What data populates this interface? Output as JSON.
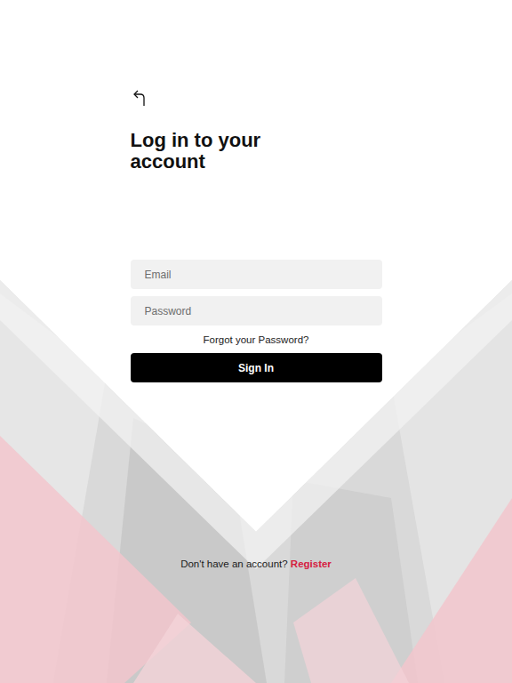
{
  "title": "Log in to your account",
  "form": {
    "email": {
      "placeholder": "Email"
    },
    "password": {
      "placeholder": "Password"
    },
    "forgot": "Forgot your Password?",
    "submit": "Sign In"
  },
  "footer": {
    "prompt": "Don't have an account?",
    "link": "Register"
  }
}
